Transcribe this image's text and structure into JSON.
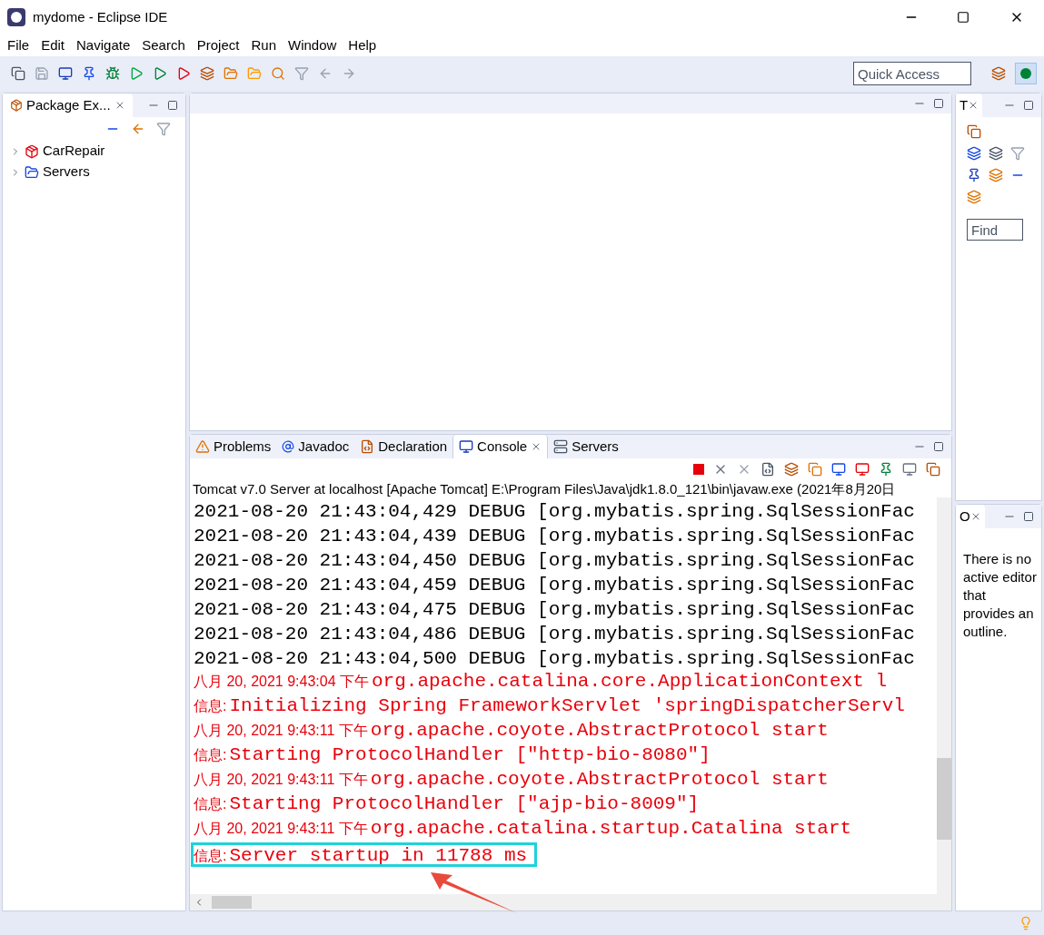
{
  "window": {
    "title": "mydome - Eclipse IDE"
  },
  "menu": [
    "File",
    "Edit",
    "Navigate",
    "Search",
    "Project",
    "Run",
    "Window",
    "Help"
  ],
  "quick_access": {
    "placeholder": "Quick Access"
  },
  "package_explorer": {
    "tab": "Package Ex...",
    "items": [
      {
        "label": "CarRepair",
        "kind": "project",
        "expanded": false
      },
      {
        "label": "Servers",
        "kind": "folder",
        "expanded": false
      }
    ]
  },
  "bottom_tabs": [
    {
      "label": "Problems",
      "kind": "problems",
      "selected": false
    },
    {
      "label": "Javadoc",
      "kind": "javadoc",
      "selected": false
    },
    {
      "label": "Declaration",
      "kind": "declaration",
      "selected": false
    },
    {
      "label": "Console",
      "kind": "console",
      "selected": true
    },
    {
      "label": "Servers",
      "kind": "servers",
      "selected": false
    }
  ],
  "console": {
    "description": "Tomcat v7.0 Server at localhost [Apache Tomcat] E:\\Program Files\\Java\\jdk1.8.0_121\\bin\\javaw.exe (2021年8月20日",
    "lines": [
      {
        "kind": "debug",
        "text": "2021-08-20 21:43:04,429 DEBUG [org.mybatis.spring.SqlSessionFac"
      },
      {
        "kind": "debug",
        "text": "2021-08-20 21:43:04,439 DEBUG [org.mybatis.spring.SqlSessionFac"
      },
      {
        "kind": "debug",
        "text": "2021-08-20 21:43:04,450 DEBUG [org.mybatis.spring.SqlSessionFac"
      },
      {
        "kind": "debug",
        "text": "2021-08-20 21:43:04,459 DEBUG [org.mybatis.spring.SqlSessionFac"
      },
      {
        "kind": "debug",
        "text": "2021-08-20 21:43:04,475 DEBUG [org.mybatis.spring.SqlSessionFac"
      },
      {
        "kind": "debug",
        "text": "2021-08-20 21:43:04,486 DEBUG [org.mybatis.spring.SqlSessionFac"
      },
      {
        "kind": "debug",
        "text": "2021-08-20 21:43:04,500 DEBUG [org.mybatis.spring.SqlSessionFac"
      },
      {
        "kind": "log",
        "prefix": "八月 20, 2021 9:43:04 下午",
        "text": "org.apache.catalina.core.ApplicationContext l",
        "highlighted": false
      },
      {
        "kind": "log",
        "prefix": "信息:",
        "text": "Initializing Spring FrameworkServlet 'springDispatcherServl",
        "highlighted": false
      },
      {
        "kind": "log",
        "prefix": "八月 20, 2021 9:43:11 下午",
        "text": "org.apache.coyote.AbstractProtocol start",
        "highlighted": false
      },
      {
        "kind": "log",
        "prefix": "信息:",
        "text": "Starting ProtocolHandler [\"http-bio-8080\"]",
        "highlighted": false
      },
      {
        "kind": "log",
        "prefix": "八月 20, 2021 9:43:11 下午",
        "text": "org.apache.coyote.AbstractProtocol start",
        "highlighted": false
      },
      {
        "kind": "log",
        "prefix": "信息:",
        "text": "Starting ProtocolHandler [\"ajp-bio-8009\"]",
        "highlighted": false
      },
      {
        "kind": "log",
        "prefix": "八月 20, 2021 9:43:11 下午",
        "text": "org.apache.catalina.startup.Catalina start",
        "highlighted": false
      },
      {
        "kind": "log",
        "prefix": "信息:",
        "text": "Server startup in 11788 ms",
        "highlighted": true
      }
    ]
  },
  "task_list": {
    "tab": "T",
    "find": {
      "placeholder": "Find"
    }
  },
  "outline": {
    "tab": "O",
    "message": "There is no active editor that provides an outline."
  }
}
